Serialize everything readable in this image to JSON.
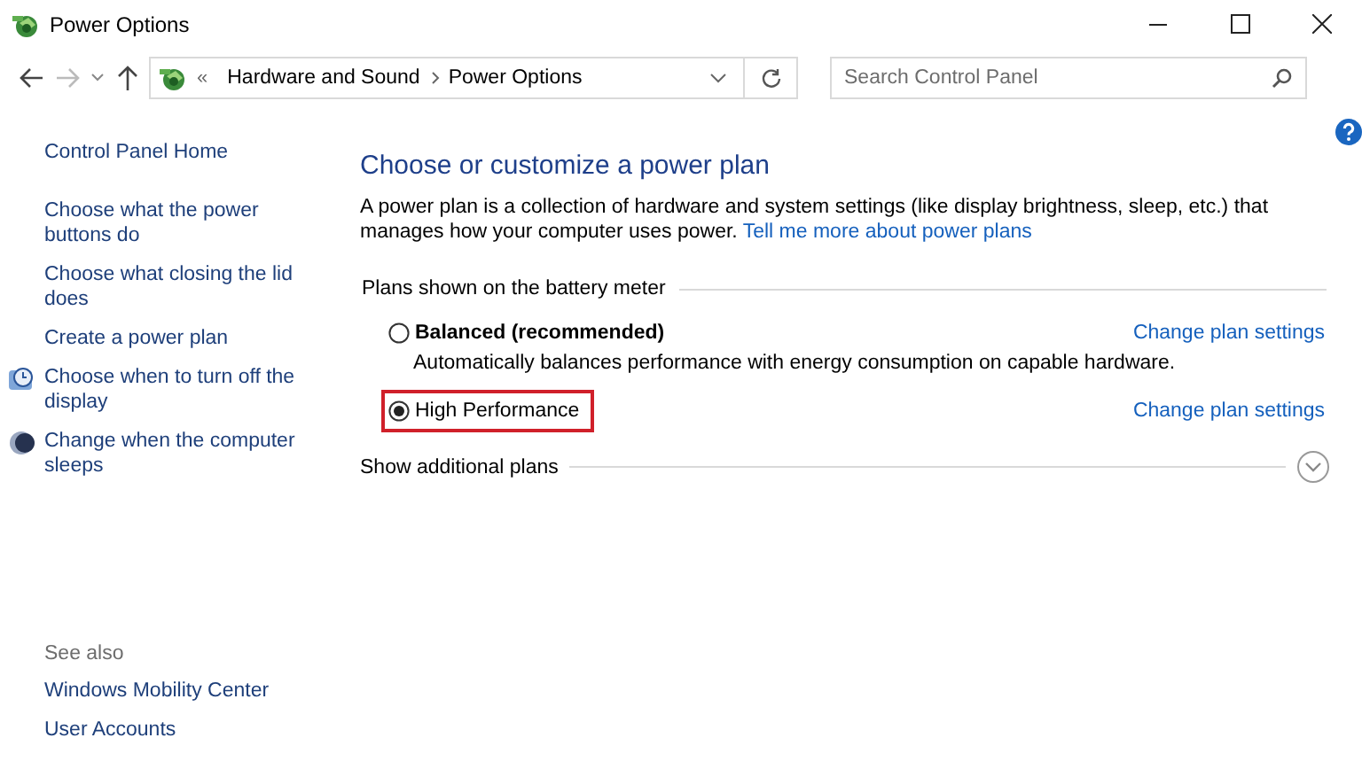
{
  "window": {
    "title": "Power Options"
  },
  "address_bar": {
    "overflow": "«",
    "path": [
      "Hardware and Sound",
      "Power Options"
    ]
  },
  "search": {
    "placeholder": "Search Control Panel"
  },
  "sidebar": {
    "items": [
      {
        "label": "Control Panel Home",
        "kind": "home"
      },
      {
        "label": "Choose what the power buttons do",
        "kind": "link"
      },
      {
        "label": "Choose what closing the lid does",
        "kind": "link"
      },
      {
        "label": "Create a power plan",
        "kind": "link"
      },
      {
        "label": "Choose when to turn off the display",
        "kind": "clock"
      },
      {
        "label": "Change when the computer sleeps",
        "kind": "moon"
      }
    ],
    "see_also": {
      "title": "See also",
      "items": [
        "Windows Mobility Center",
        "User Accounts"
      ]
    }
  },
  "main": {
    "heading": "Choose or customize a power plan",
    "description": "A power plan is a collection of hardware and system settings (like display brightness, sleep, etc.) that manages how your computer uses power.",
    "description_link": "Tell me more about power plans",
    "plans_title": "Plans shown on the battery meter",
    "plans": [
      {
        "name": "Balanced (recommended)",
        "recommended": true,
        "selected": false,
        "highlighted": false,
        "description": "Automatically balances performance with energy consumption on capable hardware.",
        "link": "Change plan settings"
      },
      {
        "name": "High Performance",
        "recommended": false,
        "selected": true,
        "highlighted": true,
        "link": "Change plan settings"
      }
    ],
    "additional": {
      "label": "Show additional plans",
      "expanded": false
    }
  }
}
